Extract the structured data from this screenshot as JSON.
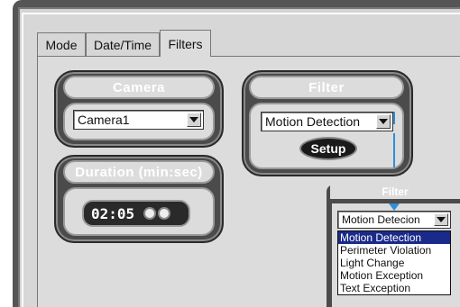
{
  "tabs": [
    {
      "label": "Mode"
    },
    {
      "label": "Date/Time"
    },
    {
      "label": "Filters"
    }
  ],
  "camera": {
    "title": "Camera",
    "selected": "Camera1"
  },
  "filter": {
    "title": "Filter",
    "selected": "Motion Detection",
    "setup_label": "Setup"
  },
  "duration": {
    "title": "Duration (min:sec)",
    "value": "02:05"
  },
  "popup": {
    "title": "Filter",
    "selected": "Motion Detecion",
    "options": [
      "Motion Detection",
      "Perimeter Violation",
      "Light Change",
      "Motion Exception",
      "Text Exception"
    ]
  },
  "colors": {
    "panel": "#4b4b4b",
    "background": "#dcdcdc",
    "highlight": "#1a2a8a",
    "callout": "#2e8fd8"
  }
}
